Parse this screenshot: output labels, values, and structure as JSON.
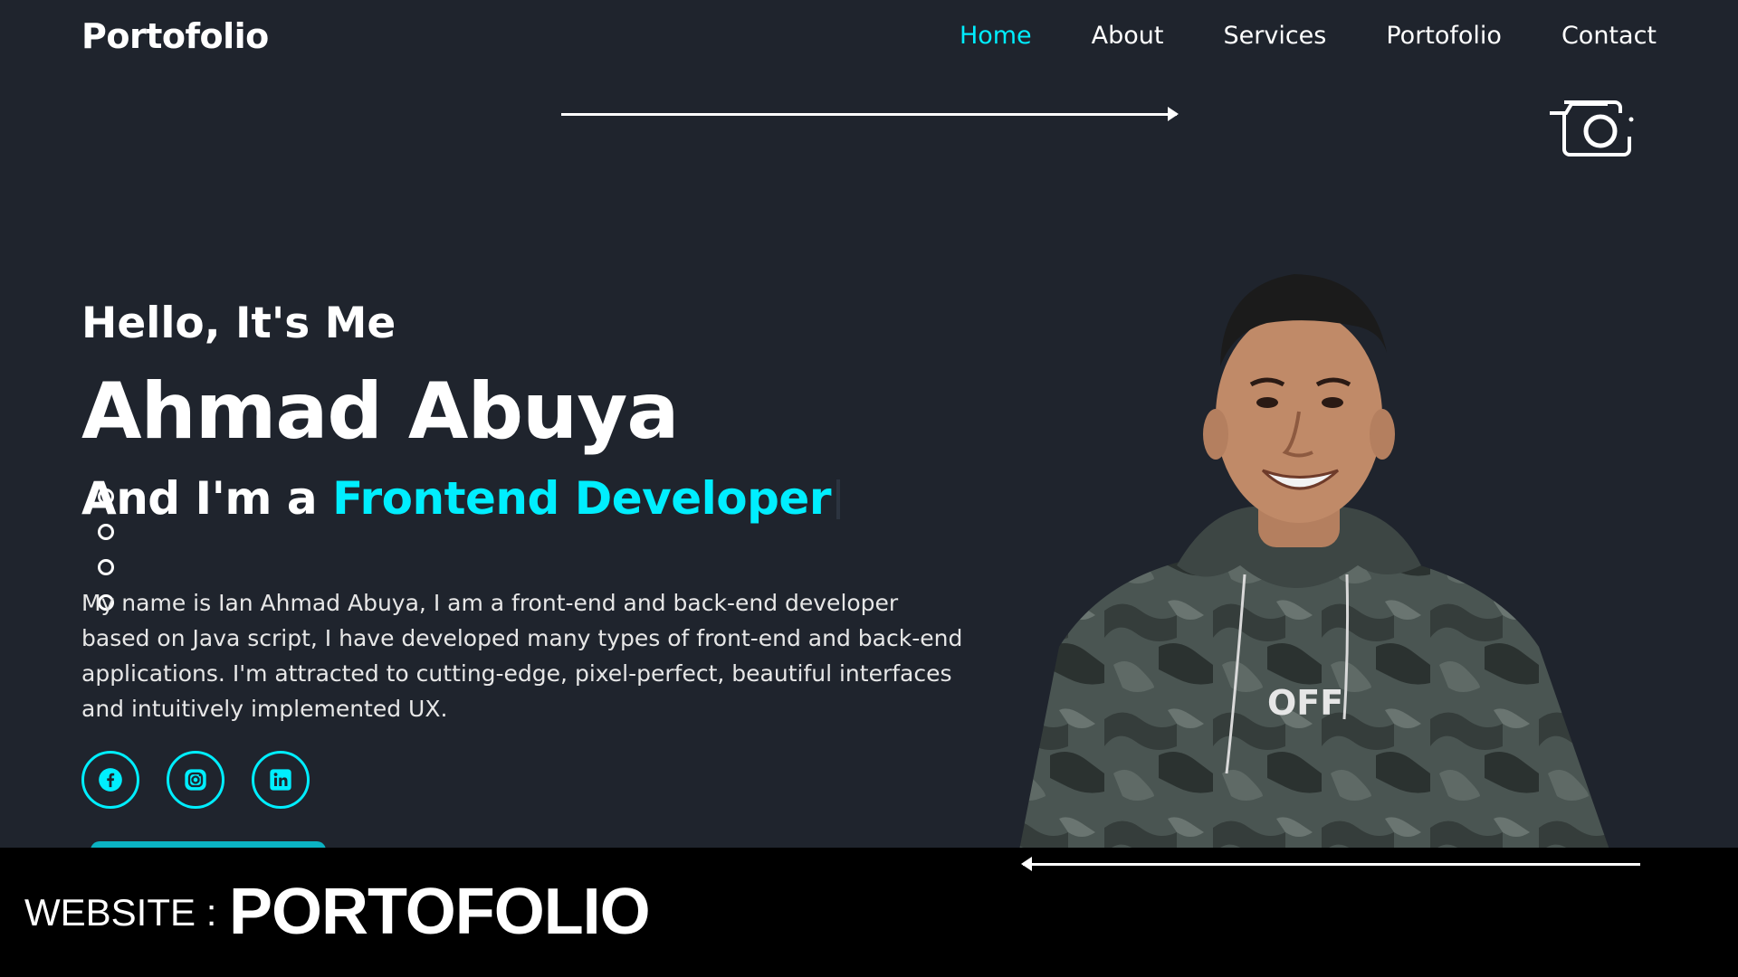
{
  "header": {
    "logo": "Portofolio",
    "nav": [
      {
        "label": "Home",
        "active": true
      },
      {
        "label": "About",
        "active": false
      },
      {
        "label": "Services",
        "active": false
      },
      {
        "label": "Portofolio",
        "active": false
      },
      {
        "label": "Contact",
        "active": false
      }
    ]
  },
  "hero": {
    "greeting": "Hello, It's Me",
    "name": "Ahmad Abuya",
    "role_prefix": "And I'm a ",
    "role_highlight": "Frontend Developer",
    "bio": "My name is Ian Ahmad Abuya, I am a front-end and back-end developer based on Java script, I have developed many types of front-end and back-end applications. I'm attracted to cutting-edge, pixel-perfect, beautiful interfaces and intuitively implemented UX.",
    "socials": [
      "facebook-icon",
      "instagram-icon",
      "linkedin-icon"
    ]
  },
  "banner": {
    "label": "WEBSITE :",
    "title": "PORTOFOLIO"
  },
  "colors": {
    "background": "#1f242d",
    "accent": "#00eeff",
    "banner": "#000000"
  }
}
